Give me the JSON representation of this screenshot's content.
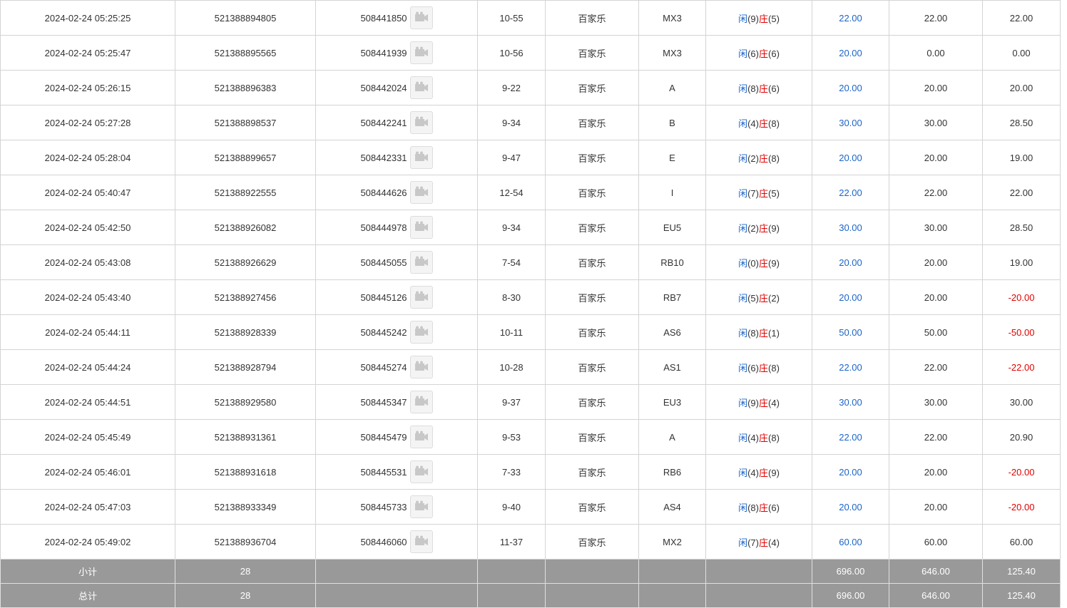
{
  "labels": {
    "player": "闲",
    "banker": "庄"
  },
  "rows": [
    {
      "time": "2024-02-24 05:25:25",
      "order": "521388894805",
      "round": "508441850",
      "shoe": "10-55",
      "game": "百家乐",
      "table": "MX3",
      "player": "9",
      "banker": "5",
      "bet": "22.00",
      "valid": "22.00",
      "win": "22.00",
      "neg": false
    },
    {
      "time": "2024-02-24 05:25:47",
      "order": "521388895565",
      "round": "508441939",
      "shoe": "10-56",
      "game": "百家乐",
      "table": "MX3",
      "player": "6",
      "banker": "6",
      "bet": "20.00",
      "valid": "0.00",
      "win": "0.00",
      "neg": false
    },
    {
      "time": "2024-02-24 05:26:15",
      "order": "521388896383",
      "round": "508442024",
      "shoe": "9-22",
      "game": "百家乐",
      "table": "A",
      "player": "8",
      "banker": "6",
      "bet": "20.00",
      "valid": "20.00",
      "win": "20.00",
      "neg": false
    },
    {
      "time": "2024-02-24 05:27:28",
      "order": "521388898537",
      "round": "508442241",
      "shoe": "9-34",
      "game": "百家乐",
      "table": "B",
      "player": "4",
      "banker": "8",
      "bet": "30.00",
      "valid": "30.00",
      "win": "28.50",
      "neg": false
    },
    {
      "time": "2024-02-24 05:28:04",
      "order": "521388899657",
      "round": "508442331",
      "shoe": "9-47",
      "game": "百家乐",
      "table": "E",
      "player": "2",
      "banker": "8",
      "bet": "20.00",
      "valid": "20.00",
      "win": "19.00",
      "neg": false
    },
    {
      "time": "2024-02-24 05:40:47",
      "order": "521388922555",
      "round": "508444626",
      "shoe": "12-54",
      "game": "百家乐",
      "table": "I",
      "player": "7",
      "banker": "5",
      "bet": "22.00",
      "valid": "22.00",
      "win": "22.00",
      "neg": false
    },
    {
      "time": "2024-02-24 05:42:50",
      "order": "521388926082",
      "round": "508444978",
      "shoe": "9-34",
      "game": "百家乐",
      "table": "EU5",
      "player": "2",
      "banker": "9",
      "bet": "30.00",
      "valid": "30.00",
      "win": "28.50",
      "neg": false
    },
    {
      "time": "2024-02-24 05:43:08",
      "order": "521388926629",
      "round": "508445055",
      "shoe": "7-54",
      "game": "百家乐",
      "table": "RB10",
      "player": "0",
      "banker": "9",
      "bet": "20.00",
      "valid": "20.00",
      "win": "19.00",
      "neg": false
    },
    {
      "time": "2024-02-24 05:43:40",
      "order": "521388927456",
      "round": "508445126",
      "shoe": "8-30",
      "game": "百家乐",
      "table": "RB7",
      "player": "5",
      "banker": "2",
      "bet": "20.00",
      "valid": "20.00",
      "win": "-20.00",
      "neg": true
    },
    {
      "time": "2024-02-24 05:44:11",
      "order": "521388928339",
      "round": "508445242",
      "shoe": "10-11",
      "game": "百家乐",
      "table": "AS6",
      "player": "8",
      "banker": "1",
      "bet": "50.00",
      "valid": "50.00",
      "win": "-50.00",
      "neg": true
    },
    {
      "time": "2024-02-24 05:44:24",
      "order": "521388928794",
      "round": "508445274",
      "shoe": "10-28",
      "game": "百家乐",
      "table": "AS1",
      "player": "6",
      "banker": "8",
      "bet": "22.00",
      "valid": "22.00",
      "win": "-22.00",
      "neg": true
    },
    {
      "time": "2024-02-24 05:44:51",
      "order": "521388929580",
      "round": "508445347",
      "shoe": "9-37",
      "game": "百家乐",
      "table": "EU3",
      "player": "9",
      "banker": "4",
      "bet": "30.00",
      "valid": "30.00",
      "win": "30.00",
      "neg": false
    },
    {
      "time": "2024-02-24 05:45:49",
      "order": "521388931361",
      "round": "508445479",
      "shoe": "9-53",
      "game": "百家乐",
      "table": "A",
      "player": "4",
      "banker": "8",
      "bet": "22.00",
      "valid": "22.00",
      "win": "20.90",
      "neg": false
    },
    {
      "time": "2024-02-24 05:46:01",
      "order": "521388931618",
      "round": "508445531",
      "shoe": "7-33",
      "game": "百家乐",
      "table": "RB6",
      "player": "4",
      "banker": "9",
      "bet": "20.00",
      "valid": "20.00",
      "win": "-20.00",
      "neg": true
    },
    {
      "time": "2024-02-24 05:47:03",
      "order": "521388933349",
      "round": "508445733",
      "shoe": "9-40",
      "game": "百家乐",
      "table": "AS4",
      "player": "8",
      "banker": "6",
      "bet": "20.00",
      "valid": "20.00",
      "win": "-20.00",
      "neg": true
    },
    {
      "time": "2024-02-24 05:49:02",
      "order": "521388936704",
      "round": "508446060",
      "shoe": "11-37",
      "game": "百家乐",
      "table": "MX2",
      "player": "7",
      "banker": "4",
      "bet": "60.00",
      "valid": "60.00",
      "win": "60.00",
      "neg": false
    }
  ],
  "subtotal": {
    "label": "小计",
    "count": "28",
    "bet": "696.00",
    "valid": "646.00",
    "win": "125.40"
  },
  "total": {
    "label": "总计",
    "count": "28",
    "bet": "696.00",
    "valid": "646.00",
    "win": "125.40"
  }
}
